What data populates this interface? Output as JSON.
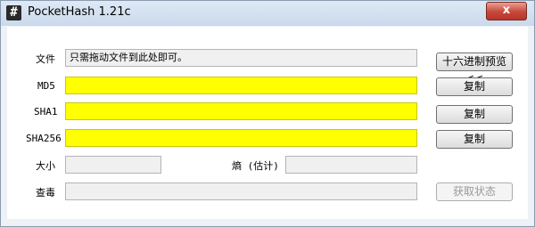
{
  "window": {
    "title": "PocketHash 1.21c",
    "icon": "hash-icon",
    "close_label": "x"
  },
  "file_row": {
    "label": "文件",
    "value": "只需拖动文件到此处即可。",
    "hex_preview_button": "十六进制预览<<"
  },
  "md5": {
    "label": "MD5",
    "value": "",
    "copy_button": "复制"
  },
  "sha1": {
    "label": "SHA1",
    "value": "",
    "copy_button": "复制"
  },
  "sha256": {
    "label": "SHA256",
    "value": "",
    "copy_button": "复制"
  },
  "size": {
    "label": "大小",
    "value": ""
  },
  "entropy": {
    "label": "熵 (估计)",
    "value": ""
  },
  "scan": {
    "label": "查毒",
    "value": "",
    "get_status_button": "获取状态"
  },
  "colors": {
    "hash_field": "#ffff00",
    "close_button": "#c6483a"
  }
}
